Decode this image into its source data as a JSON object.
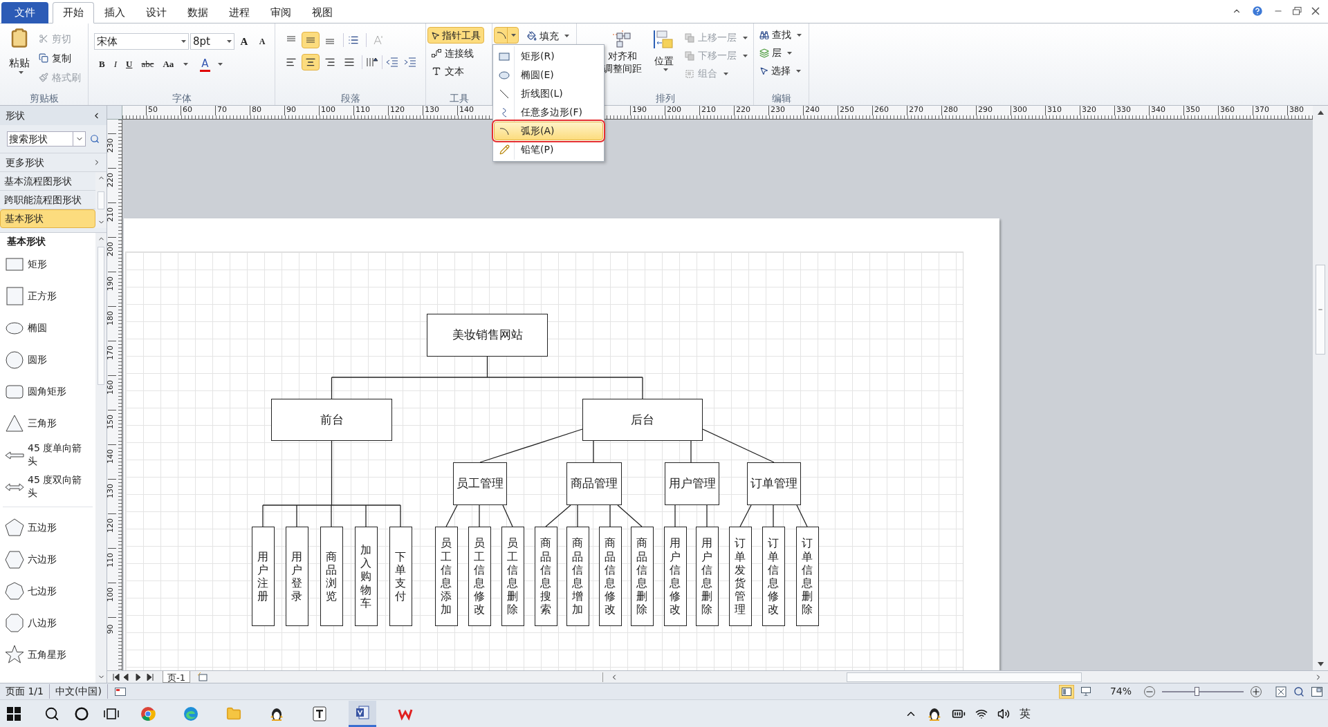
{
  "menu_tabs": [
    {
      "label": "文件",
      "kind": "file",
      "selected": false
    },
    {
      "label": "开始",
      "kind": "tab",
      "selected": true
    },
    {
      "label": "插入",
      "kind": "tab",
      "selected": false
    },
    {
      "label": "设计",
      "kind": "tab",
      "selected": false
    },
    {
      "label": "数据",
      "kind": "tab",
      "selected": false
    },
    {
      "label": "进程",
      "kind": "tab",
      "selected": false
    },
    {
      "label": "审阅",
      "kind": "tab",
      "selected": false
    },
    {
      "label": "视图",
      "kind": "tab",
      "selected": false
    }
  ],
  "clipboard": {
    "title": "剪贴板",
    "paste": "粘贴",
    "cut": {
      "label": "剪切",
      "disabled": true
    },
    "copy": {
      "label": "复制",
      "disabled": false
    },
    "format_painter": {
      "label": "格式刷",
      "disabled": true
    }
  },
  "font": {
    "title": "字体",
    "name": "宋体",
    "size": "8pt",
    "size_buttons": [
      "A",
      "A"
    ],
    "format_buttons": [
      "B",
      "I",
      "U",
      "abc",
      "Aa"
    ],
    "color_button": "A"
  },
  "paragraph": {
    "title": "段落",
    "vertical_align": [
      {
        "selected": false
      },
      {
        "selected": true
      },
      {
        "selected": false
      }
    ],
    "horizontal_align": [
      {
        "selected": false
      },
      {
        "selected": true
      },
      {
        "selected": false
      },
      {
        "selected": false
      }
    ]
  },
  "tools": {
    "title": "工具",
    "pointer": {
      "label": "指针工具",
      "selected": true
    },
    "shape_tool": {
      "selected": true
    },
    "connector": "连接线",
    "text": "文本"
  },
  "fill": "填充",
  "arrange": {
    "title": "排列",
    "align_spacing": [
      "对齐和",
      "调整间距"
    ],
    "position": "位置",
    "bring_forward": {
      "label": "上移一层",
      "disabled": true
    },
    "send_backward": {
      "label": "下移一层",
      "disabled": true
    },
    "group": {
      "label": "组合",
      "disabled": true
    }
  },
  "edit": {
    "title": "编辑",
    "find": "查找",
    "layers": "层",
    "select": "选择"
  },
  "shape_menu": [
    {
      "label": "矩形(R)",
      "kind": "rect",
      "selected": false
    },
    {
      "label": "椭圆(E)",
      "kind": "ellipse",
      "selected": false
    },
    {
      "label": "折线图(L)",
      "kind": "line",
      "selected": false
    },
    {
      "label": "任意多边形(F)",
      "kind": "freeform",
      "selected": false
    },
    {
      "label": "弧形(A)",
      "kind": "arc",
      "selected": true
    },
    {
      "label": "铅笔(P)",
      "kind": "pencil",
      "selected": false
    }
  ],
  "shapes_panel": {
    "title": "形状",
    "search": {
      "placeholder": "搜索形状"
    },
    "more": "更多形状",
    "stencils": [
      {
        "label": "基本流程图形状",
        "selected": false
      },
      {
        "label": "跨职能流程图形状",
        "selected": false
      },
      {
        "label": "基本形状",
        "selected": true
      }
    ],
    "section": "基本形状",
    "shapes": [
      {
        "label": "矩形",
        "kind": "rect"
      },
      {
        "label": "正方形",
        "kind": "square"
      },
      {
        "label": "椭圆",
        "kind": "ellipse"
      },
      {
        "label": "圆形",
        "kind": "circle"
      },
      {
        "label": "圆角矩形",
        "kind": "rounded"
      },
      {
        "label": "三角形",
        "kind": "triangle"
      },
      {
        "label": "45 度单向箭头",
        "kind": "arrow"
      },
      {
        "label": "45 度双向箭头",
        "kind": "double_arrow"
      },
      {
        "label": "五边形",
        "kind": "pentagon"
      },
      {
        "label": "六边形",
        "kind": "hexagon"
      },
      {
        "label": "七边形",
        "kind": "heptagon"
      },
      {
        "label": "八边形",
        "kind": "octagon"
      },
      {
        "label": "五角星形",
        "kind": "star"
      }
    ]
  },
  "rulers": {
    "horizontal": [
      "50",
      "60",
      "70",
      "80",
      "90",
      "100",
      "110",
      "120",
      "130",
      "140",
      "190",
      "200",
      "210",
      "220",
      "230",
      "240",
      "250",
      "260",
      "270",
      "280",
      "290",
      "300",
      "310",
      "320",
      "330",
      "340",
      "350",
      "360",
      "370",
      "380"
    ],
    "vertical": [
      "230",
      "220",
      "210",
      "200",
      "190",
      "180",
      "170",
      "160",
      "150",
      "140",
      "130",
      "120",
      "110",
      "100",
      "90"
    ]
  },
  "diagram": {
    "label": "美妆销售网站",
    "children": [
      {
        "label": "前台",
        "children": [
          {
            "label": "用户注册"
          },
          {
            "label": "用户登录"
          },
          {
            "label": "商品浏览"
          },
          {
            "label": "加入购物车"
          },
          {
            "label": "下单支付"
          }
        ]
      },
      {
        "label": "后台",
        "children": [
          {
            "label": "员工管理",
            "children": [
              {
                "label": "员工信息添加"
              },
              {
                "label": "员工信息修改"
              },
              {
                "label": "员工信息删除"
              }
            ]
          },
          {
            "label": "商品管理",
            "children": [
              {
                "label": "商品信息搜索"
              },
              {
                "label": "商品信息增加"
              },
              {
                "label": "商品信息修改"
              },
              {
                "label": "商品信息删除"
              }
            ]
          },
          {
            "label": "用户管理",
            "children": [
              {
                "label": "用户信息修改"
              },
              {
                "label": "用户信息删除"
              }
            ]
          },
          {
            "label": "订单管理",
            "children": [
              {
                "label": "订单发货管理"
              },
              {
                "label": "订单信息修改"
              },
              {
                "label": "订单信息删除"
              }
            ]
          }
        ]
      }
    ]
  },
  "page_tabs": [
    {
      "label": "页-1",
      "selected": true
    }
  ],
  "status_bar": {
    "page": "页面 1/1",
    "language": "中文(中国)",
    "zoom": "74%",
    "zoom_slider": {
      "level": 0.42
    }
  },
  "taskbar": {
    "apps": [
      {
        "kind": "chrome",
        "selected": false
      },
      {
        "kind": "edge",
        "selected": false
      },
      {
        "kind": "folder",
        "selected": false
      },
      {
        "kind": "penguin",
        "selected": false
      },
      {
        "kind": "typora",
        "selected": false
      },
      {
        "kind": "visio",
        "selected": true
      },
      {
        "kind": "wps",
        "selected": false
      }
    ],
    "ime": "英"
  }
}
